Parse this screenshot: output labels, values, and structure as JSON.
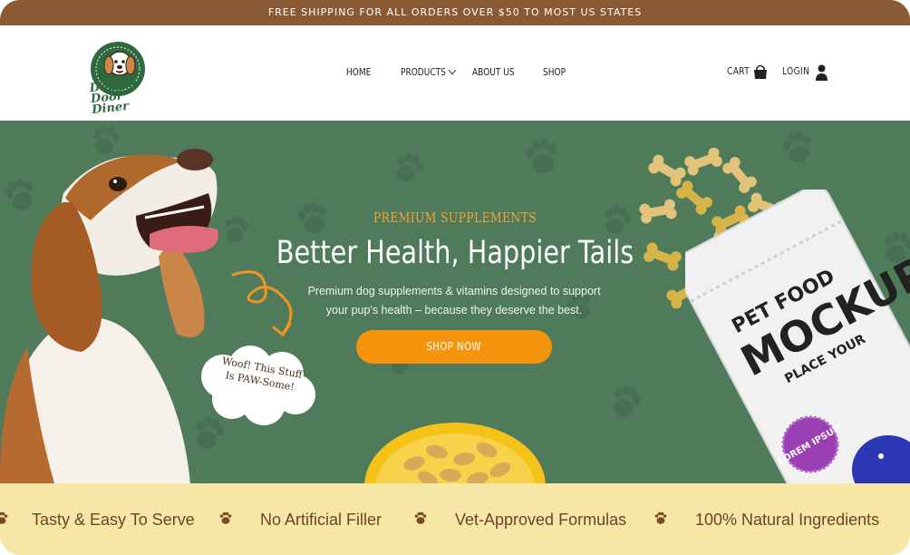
{
  "announcement": "FREE SHIPPING FOR ALL ORDERS OVER $50 TO MOST US STATES",
  "brand": {
    "logo_line1": "Doggie",
    "logo_line2": "Door Diner"
  },
  "nav": {
    "items": [
      "HOME",
      "PRODUCTS",
      "ABOUT US",
      "SHOP"
    ],
    "cart_label": "CART",
    "login_label": "LOGIN"
  },
  "hero": {
    "eyebrow": "PREMIUM SUPPLEMENTS",
    "title": "Better Health, Happier Tails",
    "subtitle": "Premium dog supplements & vitamins designed to support your pup's health – because they deserve the best.",
    "cta_label": "SHOP NOW",
    "bubble_text": "Woof! This Stuff Is PAW-Some!",
    "bag_brand": "PET FOOD",
    "bag_word": "MOCKUP",
    "bag_tag": "PLACE YOUR",
    "sticker_text": "LOREM IPSUM"
  },
  "features": [
    "Tasty & Easy To Serve",
    "No Artificial Filler",
    "Vet-Approved Formulas",
    "100% Natural Ingredients"
  ],
  "colors": {
    "topbar": "#8a5a35",
    "hero_bg": "#4f7b5b",
    "accent": "#f7940e",
    "ticker_bg": "#f7e7a6",
    "ticker_text": "#6b4526"
  }
}
